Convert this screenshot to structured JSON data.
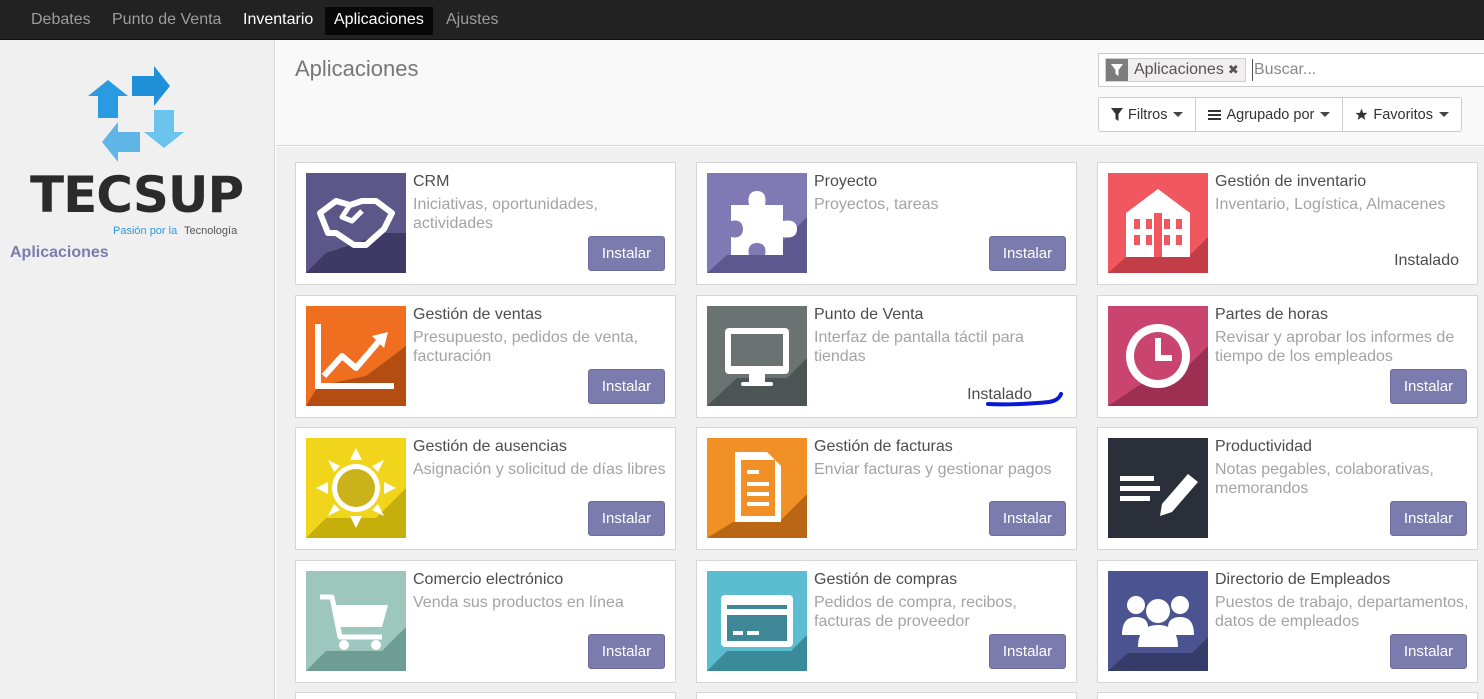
{
  "topbar": {
    "items": [
      {
        "label": "Debates"
      },
      {
        "label": "Punto de Venta"
      },
      {
        "label": "Inventario"
      },
      {
        "label": "Aplicaciones"
      },
      {
        "label": "Ajustes"
      }
    ]
  },
  "sidebar": {
    "logo_text": "TECSUP",
    "logo_tagline_1": "Pasión por la",
    "logo_tagline_2": "Tecnología",
    "items": [
      {
        "label": "Aplicaciones"
      }
    ]
  },
  "control_panel": {
    "title": "Aplicaciones",
    "search": {
      "facet": "Aplicaciones",
      "placeholder": "Buscar..."
    },
    "filters_label": "Filtros",
    "groupby_label": "Agrupado por",
    "favorites_label": "Favoritos"
  },
  "colors": {
    "primary": "#7c7bad",
    "annotation": "#0a18d6"
  },
  "apps": [
    {
      "name": "CRM",
      "desc": "Iniciativas, oportunidades, actividades",
      "action": "Instalar",
      "installed": false,
      "icon": "handshake-icon",
      "color": "#5b5788"
    },
    {
      "name": "Proyecto",
      "desc": "Proyectos, tareas",
      "action": "Instalar",
      "installed": false,
      "icon": "puzzle-icon",
      "color": "#7f7ab4"
    },
    {
      "name": "Gestión de inventario",
      "desc": "Inventario, Logística, Almacenes",
      "status": "Instalado",
      "installed": true,
      "icon": "warehouse-icon",
      "color": "#f0575f"
    },
    {
      "name": "Gestión de ventas",
      "desc": "Presupuesto, pedidos de venta, facturación",
      "action": "Instalar",
      "installed": false,
      "icon": "chart-line-icon",
      "color": "#f06e20"
    },
    {
      "name": "Punto de Venta",
      "desc": "Interfaz de pantalla táctil para tiendas",
      "status": "Instalado",
      "installed": true,
      "icon": "monitor-icon",
      "color": "#6a7272"
    },
    {
      "name": "Partes de horas",
      "desc": "Revisar y aprobar los informes de tiempo de los empleados",
      "action": "Instalar",
      "installed": false,
      "icon": "clock-icon",
      "color": "#c9456f"
    },
    {
      "name": "Gestión de ausencias",
      "desc": "Asignación y solicitud de días libres",
      "action": "Instalar",
      "installed": false,
      "icon": "sun-icon",
      "color": "#f0d51b"
    },
    {
      "name": "Gestión de facturas",
      "desc": "Enviar facturas y gestionar pagos",
      "action": "Instalar",
      "installed": false,
      "icon": "document-icon",
      "color": "#f09027"
    },
    {
      "name": "Productividad",
      "desc": "Notas pegables, colaborativas, memorandos",
      "action": "Instalar",
      "installed": false,
      "icon": "note-pencil-icon",
      "color": "#2b2f3a"
    },
    {
      "name": "Comercio electrónico",
      "desc": "Venda sus productos en línea",
      "action": "Instalar",
      "installed": false,
      "icon": "cart-icon",
      "color": "#9dc6bd"
    },
    {
      "name": "Gestión de compras",
      "desc": "Pedidos de compra, recibos, facturas de proveedor",
      "action": "Instalar",
      "installed": false,
      "icon": "credit-card-icon",
      "color": "#5cbdd0"
    },
    {
      "name": "Directorio de Empleados",
      "desc": "Puestos de trabajo, departamentos, datos de empleados",
      "action": "Instalar",
      "installed": false,
      "icon": "users-icon",
      "color": "#4b5490"
    }
  ]
}
